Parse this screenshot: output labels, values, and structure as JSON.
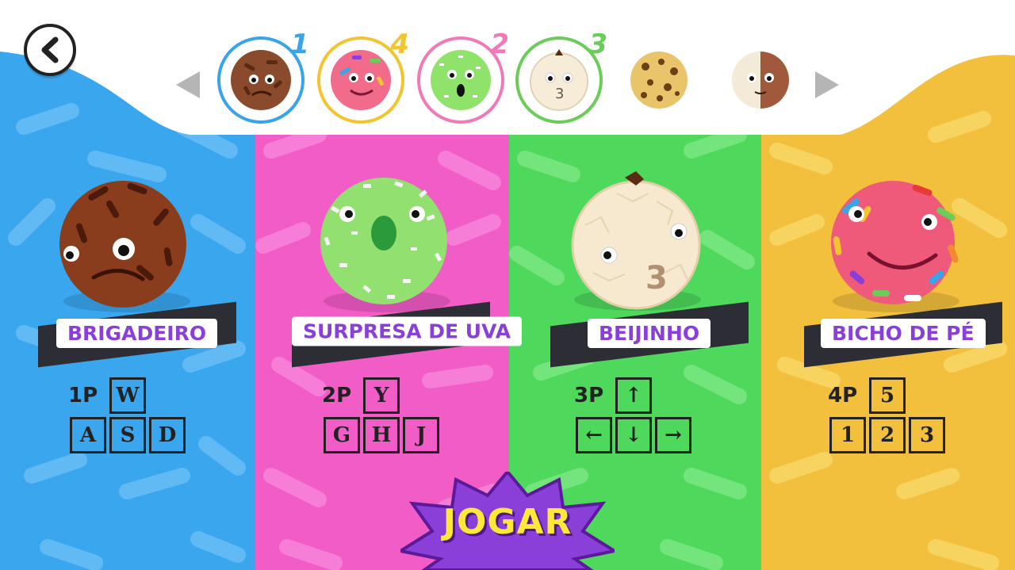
{
  "header": {
    "back_icon": "chevron-left-icon",
    "prev_icon": "triangle-left-icon",
    "next_icon": "triangle-right-icon",
    "thumbnails": [
      {
        "name": "brigadeiro",
        "player": "1",
        "ring_color": "#3aa4e8"
      },
      {
        "name": "bicho-de-pe",
        "player": "4",
        "ring_color": "#f2c430"
      },
      {
        "name": "surpresa-de-uva",
        "player": "2",
        "ring_color": "#f07ab8"
      },
      {
        "name": "beijinho",
        "player": "3",
        "ring_color": "#6ccc5a"
      },
      {
        "name": "leopard-ball",
        "player": "",
        "ring_color": ""
      },
      {
        "name": "half-ball",
        "player": "",
        "ring_color": ""
      }
    ]
  },
  "players": [
    {
      "name": "BRIGADEIRO",
      "label": "1P",
      "keys": [
        "W",
        "A",
        "S",
        "D"
      ],
      "bg": "#3aa6ee"
    },
    {
      "name": "SURPRESA DE UVA",
      "label": "2P",
      "keys": [
        "Y",
        "G",
        "H",
        "J"
      ],
      "bg": "#f25cc7"
    },
    {
      "name": "BEIJINHO",
      "label": "3P",
      "keys": [
        "↑",
        "←",
        "↓",
        "→"
      ],
      "bg": "#4ed85c"
    },
    {
      "name": "BICHO DE PÉ",
      "label": "4P",
      "keys": [
        "5",
        "1",
        "2",
        "3"
      ],
      "bg": "#f3c03e"
    }
  ],
  "play_button": {
    "label": "JOGAR",
    "color": "#8a3fd8"
  }
}
